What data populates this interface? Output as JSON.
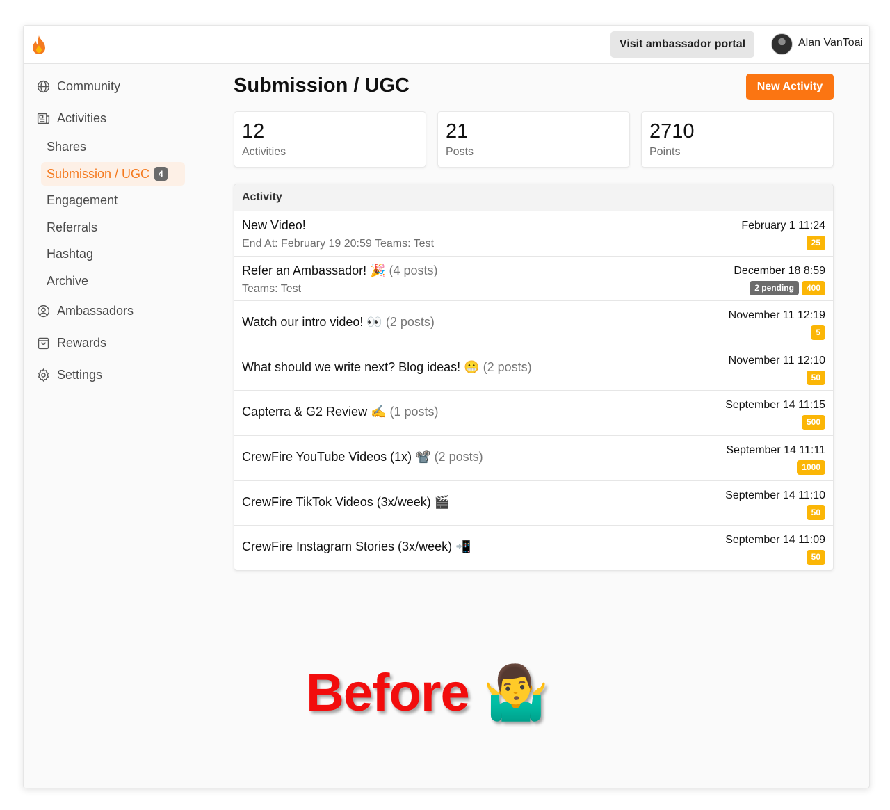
{
  "header": {
    "portal_button": "Visit ambassador portal",
    "user_name": "Alan VanToai"
  },
  "sidebar": {
    "main_items": [
      {
        "label": "Community",
        "icon": "globe-icon"
      },
      {
        "label": "Activities",
        "icon": "newspaper-icon"
      },
      {
        "label": "Ambassadors",
        "icon": "user-circle-icon"
      },
      {
        "label": "Rewards",
        "icon": "shopping-bag-icon"
      },
      {
        "label": "Settings",
        "icon": "gear-icon"
      }
    ],
    "sub_items": [
      {
        "label": "Shares"
      },
      {
        "label": "Submission / UGC",
        "badge": "4",
        "active": true
      },
      {
        "label": "Engagement"
      },
      {
        "label": "Referrals"
      },
      {
        "label": "Hashtag"
      },
      {
        "label": "Archive"
      }
    ]
  },
  "main": {
    "title": "Submission / UGC",
    "new_button": "New Activity",
    "stats": [
      {
        "value": "12",
        "label": "Activities"
      },
      {
        "value": "21",
        "label": "Posts"
      },
      {
        "value": "2710",
        "label": "Points"
      }
    ],
    "table": {
      "header": "Activity",
      "rows": [
        {
          "title": "New Video!",
          "posts": "",
          "sub": "End At: February 19 20:59  Teams: Test",
          "date": "February 1 11:24",
          "pending": "",
          "points": "25"
        },
        {
          "title": "Refer an Ambassador! 🎉",
          "posts": "(4 posts)",
          "sub": "Teams: Test",
          "date": "December 18 8:59",
          "pending": "2 pending",
          "points": "400"
        },
        {
          "title": "Watch our intro video! 👀",
          "posts": "(2 posts)",
          "sub": "",
          "date": "November 11 12:19",
          "pending": "",
          "points": "5"
        },
        {
          "title": "What should we write next? Blog ideas! 😬",
          "posts": "(2 posts)",
          "sub": "",
          "date": "November 11 12:10",
          "pending": "",
          "points": "50"
        },
        {
          "title": "Capterra & G2 Review ✍️",
          "posts": "(1 posts)",
          "sub": "",
          "date": "September 14 11:15",
          "pending": "",
          "points": "500"
        },
        {
          "title": "CrewFire YouTube Videos (1x) 📽️",
          "posts": "(2 posts)",
          "sub": "",
          "date": "September 14 11:11",
          "pending": "",
          "points": "1000"
        },
        {
          "title": "CrewFire TikTok Videos (3x/week) 🎬",
          "posts": "",
          "sub": "",
          "date": "September 14 11:10",
          "pending": "",
          "points": "50"
        },
        {
          "title": "CrewFire Instagram Stories (3x/week) 📲",
          "posts": "",
          "sub": "",
          "date": "September 14 11:09",
          "pending": "",
          "points": "50"
        }
      ]
    }
  },
  "overlay": {
    "caption": "Before 🤷‍♂️"
  },
  "colors": {
    "accent": "#fb7512",
    "points_badge": "#fbb606",
    "pending_badge": "#6b6b6b",
    "caption": "#f20d0d"
  }
}
